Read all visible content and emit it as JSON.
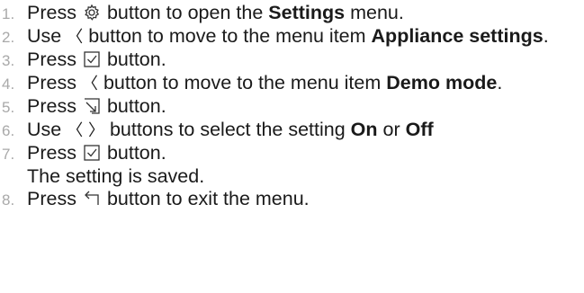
{
  "steps": [
    {
      "number": "1.",
      "parts": [
        "Press",
        "button to open the",
        "Settings",
        "menu."
      ],
      "icon": "settings-gear-icon"
    },
    {
      "number": "2.",
      "parts": [
        "Use",
        "button to move to the menu item",
        "Appliance settings",
        "."
      ],
      "icon": "chevron-left-icon",
      "icon_glyph": "〈"
    },
    {
      "number": "3.",
      "parts": [
        "Press",
        "button."
      ],
      "icon": "checkbox-check-icon"
    },
    {
      "number": "4.",
      "parts": [
        "Press",
        "button to move to the menu item",
        "Demo mode",
        "."
      ],
      "icon": "chevron-left-icon",
      "icon_glyph": "〈"
    },
    {
      "number": "5.",
      "parts": [
        "Press",
        "button."
      ],
      "icon": "enter-icon"
    },
    {
      "number": "6.",
      "parts": [
        "Use",
        "buttons to select the setting",
        "On",
        "or",
        "Off"
      ],
      "icon": "chevron-left-right-icon",
      "icon_glyph": "〈 〉"
    },
    {
      "number": "7.",
      "parts": [
        "Press",
        "button."
      ],
      "note": "The setting is saved.",
      "icon": "checkbox-check-icon"
    },
    {
      "number": "8.",
      "parts": [
        "Press",
        "button to exit the menu."
      ],
      "icon": "back-arrow-icon"
    }
  ]
}
